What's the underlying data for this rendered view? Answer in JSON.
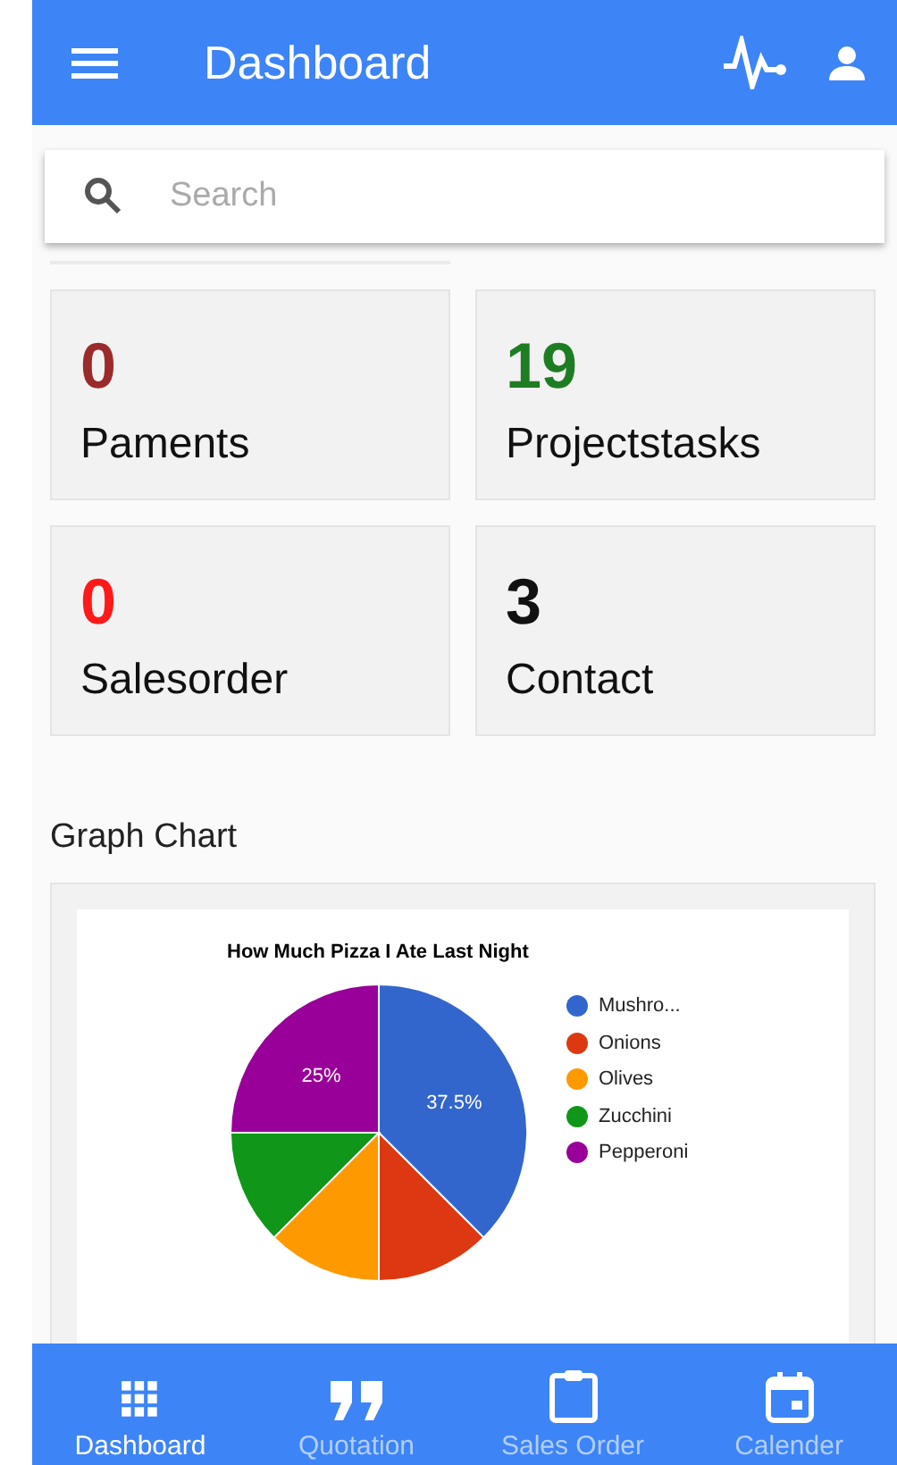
{
  "app_bar": {
    "title": "Dashboard"
  },
  "search": {
    "placeholder": "Search"
  },
  "stats": [
    {
      "value": "0",
      "label": "Paments",
      "color": "#9b2a2a"
    },
    {
      "value": "19",
      "label": "Projectstasks",
      "color": "#1e7d22"
    },
    {
      "value": "0",
      "label": "Salesorder",
      "color": "#ff1a1a"
    },
    {
      "value": "3",
      "label": "Contact",
      "color": "#111111"
    }
  ],
  "graph": {
    "heading": "Graph Chart",
    "chart_data": {
      "type": "pie",
      "title": "How Much Pizza I Ate Last Night",
      "categories": [
        "Mushro...",
        "Onions",
        "Olives",
        "Zucchini",
        "Pepperoni"
      ],
      "values": [
        37.5,
        12.5,
        12.5,
        12.5,
        25
      ],
      "colors": [
        "#3366cc",
        "#dc3912",
        "#ff9900",
        "#109618",
        "#990099"
      ],
      "value_labels": [
        "37.5%",
        null,
        null,
        null,
        "25%"
      ],
      "legend": "right"
    }
  },
  "bottom_nav": [
    {
      "label": "Dashboard",
      "kind": "grid",
      "selected": true
    },
    {
      "label": "Quotation",
      "kind": "quote",
      "selected": false
    },
    {
      "label": "Sales Order",
      "kind": "clipboard",
      "selected": false
    },
    {
      "label": "Calender",
      "kind": "calendar",
      "selected": false
    }
  ]
}
